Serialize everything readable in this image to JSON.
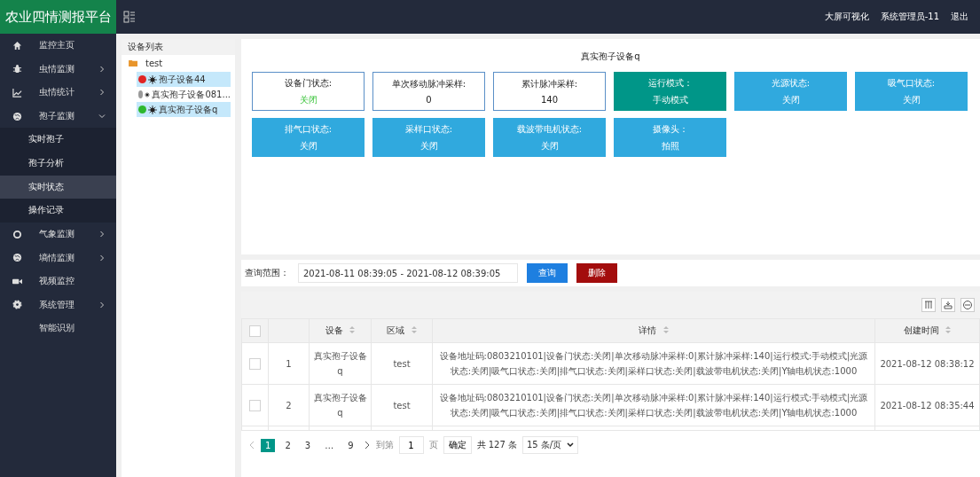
{
  "header": {
    "title": "农业四情测报平台",
    "links": [
      "大屏可视化",
      "系统管理员-11",
      "退出"
    ]
  },
  "sidebar": {
    "items": [
      {
        "label": "监控主页"
      },
      {
        "label": "虫情监测",
        "expanded": false
      },
      {
        "label": "虫情统计",
        "expanded": false
      },
      {
        "label": "孢子监测",
        "expanded": true,
        "children": [
          {
            "label": "实时孢子",
            "selected": false
          },
          {
            "label": "孢子分析",
            "selected": false
          },
          {
            "label": "实时状态",
            "selected": true
          },
          {
            "label": "操作记录",
            "selected": false
          }
        ]
      },
      {
        "label": "气象监测",
        "expanded": false
      },
      {
        "label": "墒情监测",
        "expanded": false
      },
      {
        "label": "视频监控"
      },
      {
        "label": "系统管理",
        "expanded": false
      },
      {
        "label": "智能识别"
      }
    ]
  },
  "device_tree": {
    "title": "设备列表",
    "group": "test",
    "devices": [
      {
        "name": "孢子设备44",
        "color": "#e02424",
        "selected": true
      },
      {
        "name": "真实孢子设备081...",
        "color": "#9a9a9a",
        "selected": false
      },
      {
        "name": "真实孢子设备q",
        "color": "#2eb82e",
        "selected": true
      }
    ]
  },
  "status": {
    "title": "真实孢子设备q",
    "cards": [
      {
        "kind": "outline",
        "label": "设备门状态:",
        "value": "关闭",
        "ok": true
      },
      {
        "kind": "outline",
        "label": "单次移动脉冲采样:",
        "value": "0"
      },
      {
        "kind": "outline",
        "label": "累计脉冲采样:",
        "value": "140"
      },
      {
        "kind": "mode",
        "label": "运行模式：",
        "value": "手动模式"
      },
      {
        "kind": "status",
        "label": "光源状态:",
        "value": "关闭"
      },
      {
        "kind": "status",
        "label": "吸气口状态:",
        "value": "关闭"
      },
      {
        "kind": "status",
        "label": "排气口状态:",
        "value": "关闭"
      },
      {
        "kind": "status",
        "label": "采样口状态:",
        "value": "关闭"
      },
      {
        "kind": "status",
        "label": "载波带电机状态:",
        "value": "关闭"
      },
      {
        "kind": "status",
        "label": "摄像头：",
        "value": "拍照"
      }
    ]
  },
  "query": {
    "label": "查询范围：",
    "range": "2021-08-11 08:39:05 - 2021-08-12 08:39:05",
    "buttons": [
      "查询",
      "删除"
    ]
  },
  "table": {
    "all_checked": false,
    "columns": [
      "设备",
      "区域",
      "详情",
      "创建时间"
    ],
    "rows": [
      {
        "checked": false,
        "index": "1",
        "device": "真实孢子设备q",
        "area": "test",
        "detail": "设备地址码:0803210101|设备门状态:关闭|单次移动脉冲采样:0|累计脉冲采样:140|运行模式:手动模式|光源状态:关闭|吸气口状态:关闭|排气口状态:关闭|采样口状态:关闭|载波带电机状态:关闭|Y轴电机状态:1000",
        "time": "2021-08-12 08:38:12"
      },
      {
        "checked": false,
        "index": "2",
        "device": "真实孢子设备q",
        "area": "test",
        "detail": "设备地址码:0803210101|设备门状态:关闭|单次移动脉冲采样:0|累计脉冲采样:140|运行模式:手动模式|光源状态:关闭|吸气口状态:关闭|排气口状态:关闭|采样口状态:关闭|载波带电机状态:关闭|Y轴电机状态:1000",
        "time": "2021-08-12 08:35:44"
      }
    ]
  },
  "pagination": {
    "pages": [
      {
        "label": "1",
        "selected": true
      },
      {
        "label": "2",
        "selected": false
      },
      {
        "label": "3",
        "selected": false
      },
      {
        "label": "…",
        "selected": false
      },
      {
        "label": "9",
        "selected": false
      }
    ],
    "goto_label": "到第",
    "goto_value": "1",
    "page_unit": "页",
    "confirm": "确定",
    "total": "共 127 条",
    "page_size": "15 条/页"
  }
}
